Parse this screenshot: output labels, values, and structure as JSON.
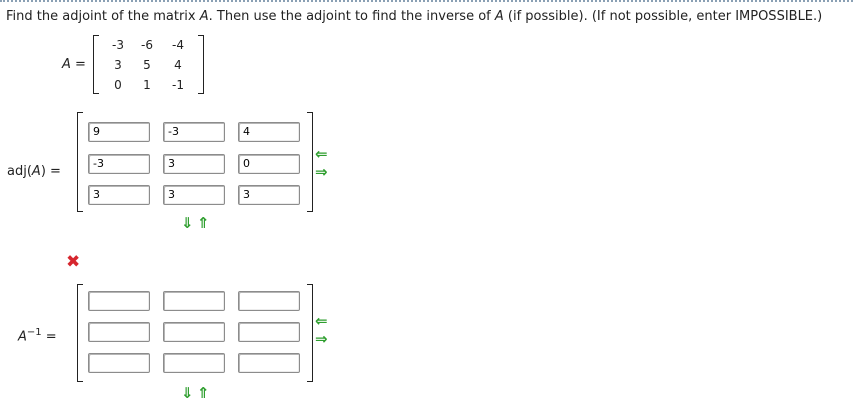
{
  "prompt": {
    "before_A": "Find the adjoint of the matrix ",
    "A_symbol": "A",
    "middle": ". Then use the adjoint to find the inverse of ",
    "A_symbol_2": "A",
    "after": " (if possible). (If not possible, enter IMPOSSIBLE.)"
  },
  "matrix_A": {
    "label_symbol": "A",
    "label_eq": " =",
    "rows": [
      [
        "-3",
        "-6",
        "-4"
      ],
      [
        "3",
        "5",
        "4"
      ],
      [
        "0",
        "1",
        "-1"
      ]
    ]
  },
  "adjoint": {
    "label_prefix": "adj(",
    "label_symbol": "A",
    "label_suffix": ") =",
    "values": [
      [
        "9",
        "-3",
        "4"
      ],
      [
        "-3",
        "3",
        "0"
      ],
      [
        "3",
        "3",
        "3"
      ]
    ],
    "status_icon": "x-mark-icon",
    "status_color": "#d6262e"
  },
  "inverse": {
    "label_symbol": "A",
    "label_exp": "−1",
    "label_eq": " =",
    "values": [
      [
        "",
        "",
        ""
      ],
      [
        "",
        "",
        ""
      ],
      [
        "",
        "",
        ""
      ]
    ]
  },
  "controls": {
    "arrow_color": "#2e9e2e",
    "resize_icons": [
      "arrow-left-icon",
      "arrow-right-icon",
      "arrow-down-icon",
      "arrow-up-icon"
    ]
  }
}
